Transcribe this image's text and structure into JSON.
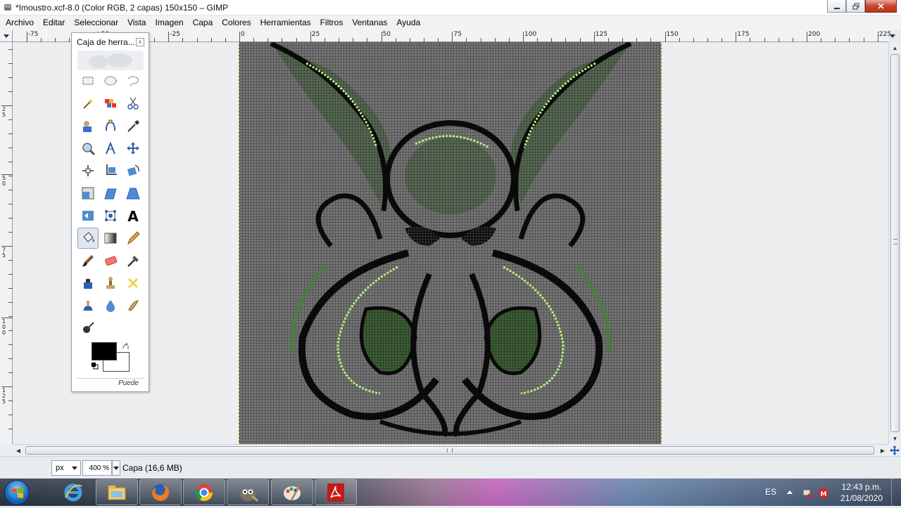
{
  "window": {
    "title": "*Imoustro.xcf-8.0 (Color RGB, 2 capas) 150x150 – GIMP",
    "close_glyph": "✕"
  },
  "menu": [
    {
      "label": "Archivo"
    },
    {
      "label": "Editar"
    },
    {
      "label": "Seleccionar"
    },
    {
      "label": "Vista"
    },
    {
      "label": "Imagen"
    },
    {
      "label": "Capa"
    },
    {
      "label": "Colores"
    },
    {
      "label": "Herramientas"
    },
    {
      "label": "Filtros"
    },
    {
      "label": "Ventanas"
    },
    {
      "label": "Ayuda"
    }
  ],
  "ruler": {
    "h_labels": [
      "-75",
      "-50",
      "-25",
      "0",
      "25",
      "50",
      "75",
      "100",
      "125",
      "150",
      "175",
      "200",
      "225"
    ],
    "v_labels": [
      "2\n5",
      "5\n0",
      "7\n5",
      "1\n0\n0",
      "1\n2\n5"
    ]
  },
  "toolbox": {
    "title": "Caja de herra...",
    "close_glyph": "x",
    "footer": "Puede",
    "tools": [
      "rect-select-icon",
      "ellipse-select-icon",
      "free-select-icon",
      "fuzzy-select-icon",
      "select-by-color-icon",
      "scissors-icon",
      "foreground-select-icon",
      "paths-icon",
      "color-picker-icon",
      "zoom-icon",
      "measure-icon",
      "move-icon",
      "align-icon",
      "crop-icon",
      "rotate-icon",
      "scale-icon",
      "shear-icon",
      "perspective-icon",
      "flip-icon",
      "cage-icon",
      "text-icon",
      "bucket-fill-icon",
      "blend-icon",
      "pencil-icon",
      "paintbrush-icon",
      "eraser-icon",
      "airbrush-icon",
      "ink-icon",
      "clone-icon",
      "heal-icon",
      "perspective-clone-icon",
      "blur-icon",
      "smudge-icon",
      "dodge-burn-icon"
    ],
    "active_tool": "bucket-fill-icon",
    "fg_color": "#000000",
    "bg_color": "#ffffff"
  },
  "status": {
    "unit": "px",
    "zoom": "400 %",
    "info": "Capa (16,6 MB)"
  },
  "taskbar": {
    "apps": [
      "internet-explorer-icon",
      "file-explorer-icon",
      "firefox-icon",
      "chrome-icon",
      "gimp-icon",
      "paint-icon",
      "acrobat-icon"
    ],
    "language": "ES",
    "time": "12:43 p.m.",
    "date": "21/08/2020"
  },
  "colors": {
    "pixel_grid": "#4a4a4a",
    "image_bg": "#6e6e6e",
    "outline": "#050505",
    "dark_green": "#2f4a2a",
    "mid_green": "#4e7a43",
    "light_green": "#b6f27a"
  }
}
